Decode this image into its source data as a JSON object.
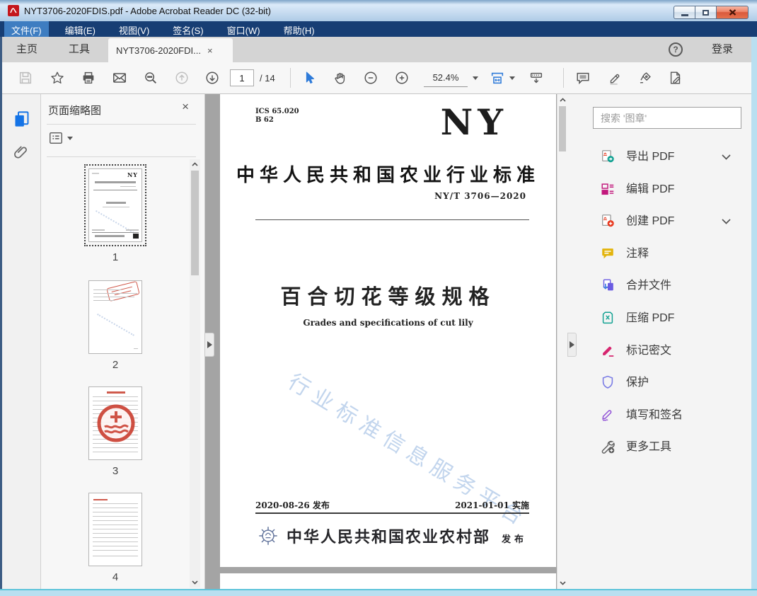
{
  "window": {
    "title": "NYT3706-2020FDIS.pdf - Adobe Acrobat Reader DC (32-bit)"
  },
  "menubar": {
    "items": [
      "文件(F)",
      "编辑(E)",
      "视图(V)",
      "签名(S)",
      "窗口(W)",
      "帮助(H)"
    ]
  },
  "tabs": {
    "home": "主页",
    "tools": "工具",
    "document": "NYT3706-2020FDI...",
    "close_glyph": "×",
    "help_glyph": "?",
    "signin": "登录"
  },
  "toolbar": {
    "page_current": "1",
    "page_total": "/ 14",
    "zoom_level": "52.4%"
  },
  "thumb_panel": {
    "title": "页面缩略图",
    "close_glyph": "×",
    "pages": [
      "1",
      "2",
      "3",
      "4"
    ]
  },
  "document": {
    "ics_code": "ICS 65.020",
    "class_code": "B 62",
    "logo_text": "NY",
    "standard_name": "中华人民共和国农业行业标准",
    "standard_number": "NY/T 3706—2020",
    "title_cn": "百合切花等级规格",
    "title_en": "Grades and specifications of cut lily",
    "watermark": "行业标准信息服务平台",
    "release_date": "2020-08-26 发布",
    "implement_date": "2021-01-01 实施",
    "publisher": "中华人民共和国农业农村部",
    "publish_label": "发布"
  },
  "right_panel": {
    "search_placeholder": "搜索 '图章'",
    "tools": [
      {
        "label": "导出 PDF",
        "expandable": true
      },
      {
        "label": "编辑 PDF",
        "expandable": false
      },
      {
        "label": "创建 PDF",
        "expandable": true
      },
      {
        "label": "注释",
        "expandable": false
      },
      {
        "label": "合并文件",
        "expandable": false
      },
      {
        "label": "压缩 PDF",
        "expandable": false
      },
      {
        "label": "标记密文",
        "expandable": false
      },
      {
        "label": "保护",
        "expandable": false
      },
      {
        "label": "填写和签名",
        "expandable": false
      },
      {
        "label": "更多工具",
        "expandable": false
      }
    ]
  },
  "colors": {
    "accent_blue": "#1473e6",
    "menu_bar": "#173e74",
    "close_button": "#d9593c",
    "export_teal": "#12a192",
    "create_red": "#e8391f",
    "edit_magenta": "#c2187c",
    "comment_gold": "#e3b40c",
    "combine_purple": "#6a5be2",
    "redact_magenta": "#d6246e",
    "protect_violet": "#7a7ce5",
    "fillsign_purple": "#8f4fd6",
    "watermark_blue": "#b3cbe9"
  }
}
